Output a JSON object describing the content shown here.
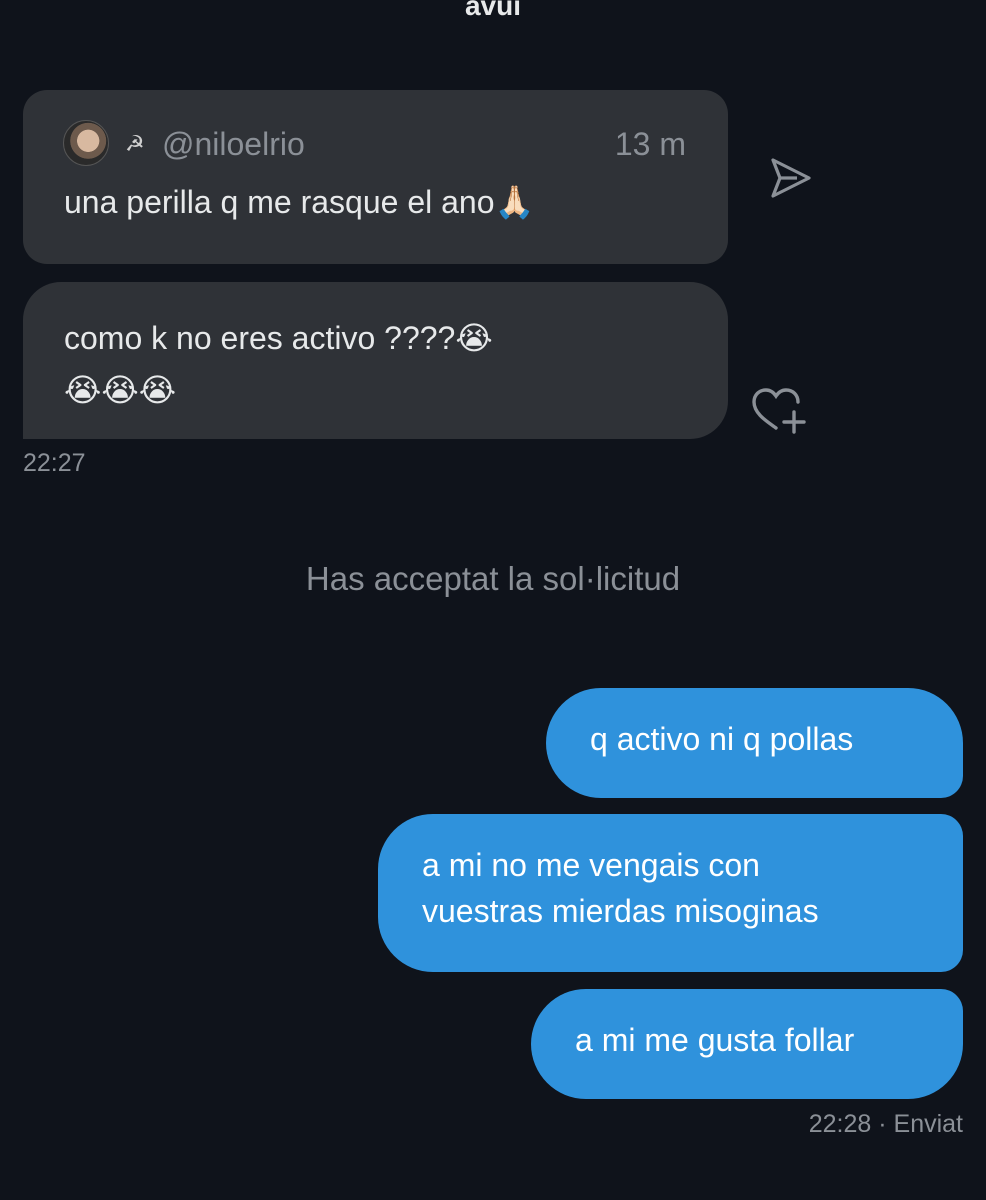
{
  "date_header": "avui",
  "quoted_message": {
    "emblem": "☭",
    "handle": "@niloelrio",
    "time": "13 m",
    "text": "una perilla q me rasque el ano🙏🏻"
  },
  "incoming_message": {
    "line1": "como k no eres activo ????😭",
    "line2": "😭😭😭",
    "time": "22:27"
  },
  "system_message": "Has acceptat la sol·licitud",
  "outgoing_messages": [
    {
      "lines": [
        "q activo ni q pollas"
      ]
    },
    {
      "lines": [
        "a mi no me vengais con",
        "vuestras mierdas misoginas"
      ]
    },
    {
      "lines": [
        "a mi me gusta follar"
      ]
    }
  ],
  "outgoing_status": {
    "time": "22:28",
    "separator": "·",
    "status": "Enviat"
  },
  "icons": {
    "share": "send-icon",
    "react": "heart-plus-icon",
    "avatar": "avatar"
  },
  "colors": {
    "background": "#0f131b",
    "incoming_bubble": "#2f3237",
    "outgoing_bubble": "#2f92dc",
    "muted_text": "#8b9097"
  }
}
